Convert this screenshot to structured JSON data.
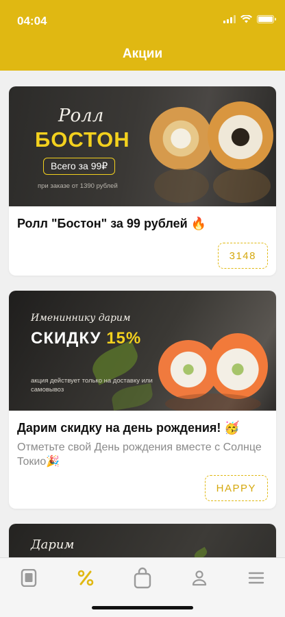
{
  "status_bar": {
    "time": "04:04"
  },
  "header": {
    "title": "Акции"
  },
  "promos": [
    {
      "banner": {
        "script": "Ролл",
        "headline": "БОСТОН",
        "pill": "Всего за 99₽",
        "note": "при заказе от 1390 рублей"
      },
      "title": "Ролл \"Бостон\" за 99 рублей 🔥",
      "code": "3148"
    },
    {
      "banner": {
        "script": "Имениннику дарим",
        "headline": "СКИДКУ",
        "accent": "15%",
        "note": "акция действует только на доставку или самовывоз"
      },
      "title": "Дарим скидку на день рождения! 🥳",
      "description": "Отметьте свой День рождения вместе с Солнце Токио🎉",
      "code": "HAPPY"
    },
    {
      "banner": {
        "script": "Дарим"
      }
    }
  ],
  "tabbar": {
    "items": [
      {
        "icon": "menu-book-icon",
        "active": false
      },
      {
        "icon": "percent-icon",
        "active": true
      },
      {
        "icon": "shopping-bag-icon",
        "active": false
      },
      {
        "icon": "profile-icon",
        "active": false
      },
      {
        "icon": "hamburger-menu-icon",
        "active": false
      }
    ]
  },
  "colors": {
    "accent": "#e0b812",
    "banner_yellow": "#f3d11e",
    "inactive_icon": "#9a9a9a"
  }
}
